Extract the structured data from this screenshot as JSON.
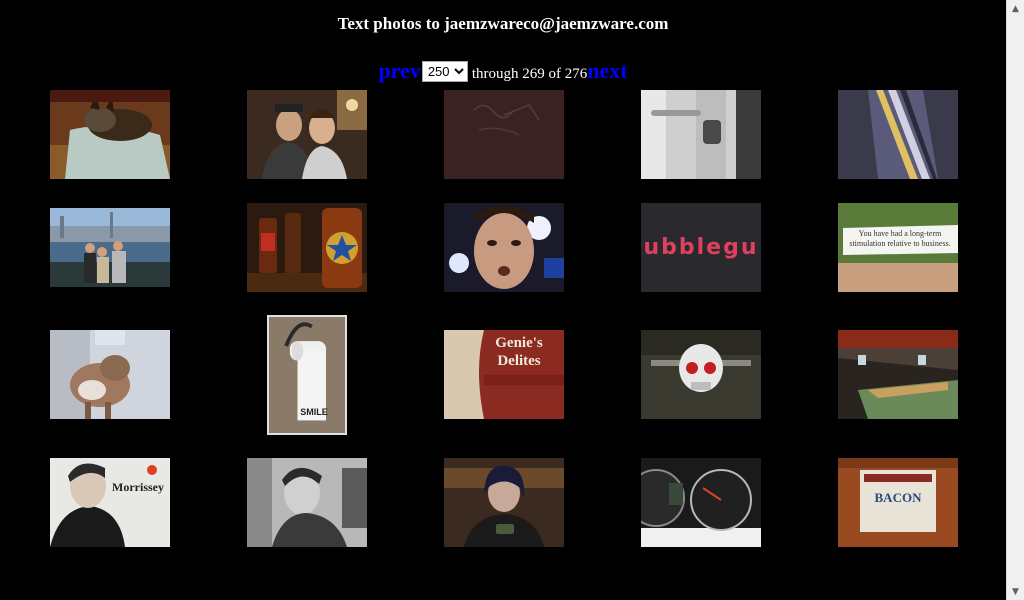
{
  "header": {
    "title": "Text photos to jaemzwareco@jaemzware.com"
  },
  "pagination": {
    "prev_label": "prev",
    "next_label": "next",
    "selected_start": "250",
    "range_text": "through 269 of 276"
  },
  "photos": [
    {
      "name": "photo-dog-on-blanket",
      "caption": ""
    },
    {
      "name": "photo-couple-selfie",
      "caption": ""
    },
    {
      "name": "photo-dark-wall-scribbles",
      "caption": ""
    },
    {
      "name": "photo-door-latch",
      "caption": ""
    },
    {
      "name": "photo-striped-tie",
      "caption": ""
    },
    {
      "name": "photo-family-waterfront",
      "caption": ""
    },
    {
      "name": "photo-beer-bottles",
      "caption": ""
    },
    {
      "name": "photo-face-closeup",
      "caption": ""
    },
    {
      "name": "photo-bubblegum-sign",
      "caption": "ubblegu"
    },
    {
      "name": "photo-fortune-cookie",
      "caption": "You have had a long-term stimulation relative to business."
    },
    {
      "name": "photo-small-dog",
      "caption": ""
    },
    {
      "name": "photo-toilet-paper",
      "caption": "SMILE"
    },
    {
      "name": "photo-genies-delites",
      "caption": "Genie's Delites"
    },
    {
      "name": "photo-skull-ornament",
      "caption": ""
    },
    {
      "name": "photo-porch-ceiling",
      "caption": ""
    },
    {
      "name": "photo-morrissey-poster",
      "caption": "Morrissey"
    },
    {
      "name": "photo-man-poster-bw",
      "caption": ""
    },
    {
      "name": "photo-person-phone",
      "caption": ""
    },
    {
      "name": "photo-speedometer",
      "caption": ""
    },
    {
      "name": "photo-bourbon-bacon-label",
      "caption": "BACON"
    }
  ],
  "colors": {
    "background": "#000000",
    "link": "#0000ff",
    "text": "#ffffff"
  }
}
